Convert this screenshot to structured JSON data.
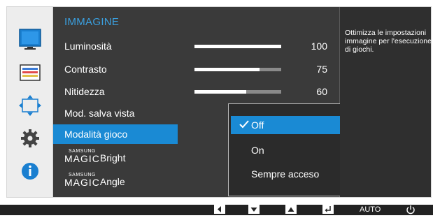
{
  "menu": {
    "title": "IMMAGINE",
    "items": [
      {
        "label": "Luminosità",
        "value": "100",
        "level": 100
      },
      {
        "label": "Contrasto",
        "value": "75",
        "level": 75
      },
      {
        "label": "Nitidezza",
        "value": "60",
        "level": 60
      },
      {
        "label": "Mod. salva vista"
      },
      {
        "label": "Modalità gioco"
      },
      {
        "brand_small": "SAMSUNG",
        "brand_big": "MAGIC",
        "label": "Bright"
      },
      {
        "brand_small": "SAMSUNG",
        "brand_big": "MAGIC",
        "label": "Angle"
      }
    ]
  },
  "dropdown": {
    "options": [
      "Off",
      "On",
      "Sempre acceso"
    ],
    "selected_index": 0
  },
  "description": "Ottimizza le impostazioni immagine per l'esecuzione di giochi.",
  "bottom_bar": {
    "auto_label": "AUTO"
  },
  "sidebar": {
    "icons": [
      "monitor-icon",
      "color-bars-icon",
      "resize-arrows-icon",
      "gear-icon",
      "info-icon"
    ]
  },
  "colors": {
    "accent": "#1a8ad4",
    "title": "#3aa0e0",
    "panel": "#3a3a3a"
  }
}
